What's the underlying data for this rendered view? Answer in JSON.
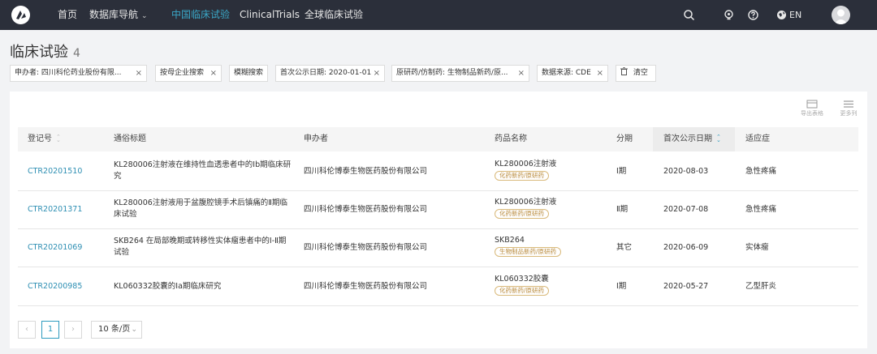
{
  "nav": {
    "items": [
      {
        "label": "首页"
      },
      {
        "label": "数据库导航"
      },
      {
        "label": "中国临床试验"
      },
      {
        "label": "ClinicalTrials"
      },
      {
        "label": "全球临床试验"
      }
    ],
    "dropdown_icon": "chevron-down-icon",
    "active_index": 2,
    "active_color": "#3aa7c7",
    "bar_color": "#2b2f3a",
    "language": "EN",
    "icons": [
      "search-icon",
      "bulb-icon",
      "help-icon",
      "globe-icon",
      "user-avatar-icon"
    ]
  },
  "page": {
    "title": "临床试验",
    "count": "4"
  },
  "filters": [
    {
      "label": "申办者: 四川科伦药业股份有限..."
    },
    {
      "label": "按母企业搜索"
    },
    {
      "label": "模糊搜索"
    },
    {
      "label": "首次公示日期: 2020-01-01"
    },
    {
      "label": "原研药/仿制药: 生物制品新药/原..."
    },
    {
      "label": "数据来源: CDE"
    },
    {
      "label": "清空"
    }
  ],
  "toolbar": {
    "export_label": "导出表格",
    "more_columns_label": "更多列"
  },
  "table": {
    "columns": [
      "登记号",
      "通俗标题",
      "申办者",
      "药品名称",
      "分期",
      "首次公示日期",
      "适应症"
    ],
    "sorted_column": "首次公示日期",
    "rows": [
      {
        "reg_no": "CTR20201510",
        "title": "KL280006注射液在维持性血透患者中的Ⅰb期临床研究",
        "sponsor": "四川科伦博泰生物医药股份有限公司",
        "drug": "KL280006注射液",
        "drug_tag": "化药新药/原研药",
        "phase": "Ⅰ期",
        "date": "2020-08-03",
        "indication": "急性疼痛"
      },
      {
        "reg_no": "CTR20201371",
        "title": "KL280006注射液用于盆腹腔镜手术后镇痛的Ⅱ期临床试验",
        "sponsor": "四川科伦博泰生物医药股份有限公司",
        "drug": "KL280006注射液",
        "drug_tag": "化药新药/原研药",
        "phase": "Ⅱ期",
        "date": "2020-07-08",
        "indication": "急性疼痛"
      },
      {
        "reg_no": "CTR20201069",
        "title": "SKB264 在局部晚期或转移性实体瘤患者中的Ⅰ-Ⅱ期试验",
        "sponsor": "四川科伦博泰生物医药股份有限公司",
        "drug": "SKB264",
        "drug_tag": "生物制品新药/原研药",
        "phase": "其它",
        "date": "2020-06-09",
        "indication": "实体瘤"
      },
      {
        "reg_no": "CTR20200985",
        "title": "KL060332胶囊的Ia期临床研究",
        "sponsor": "四川科伦博泰生物医药股份有限公司",
        "drug": "KL060332胶囊",
        "drug_tag": "化药新药/原研药",
        "phase": "Ⅰ期",
        "date": "2020-05-27",
        "indication": "乙型肝炎"
      }
    ]
  },
  "pagination": {
    "prev": "‹",
    "current": "1",
    "next": "›",
    "page_size": "10 条/页"
  },
  "colors": {
    "link": "#2e8fb3",
    "tag": "#b8893a",
    "page_bg": "#f2f3f5"
  }
}
